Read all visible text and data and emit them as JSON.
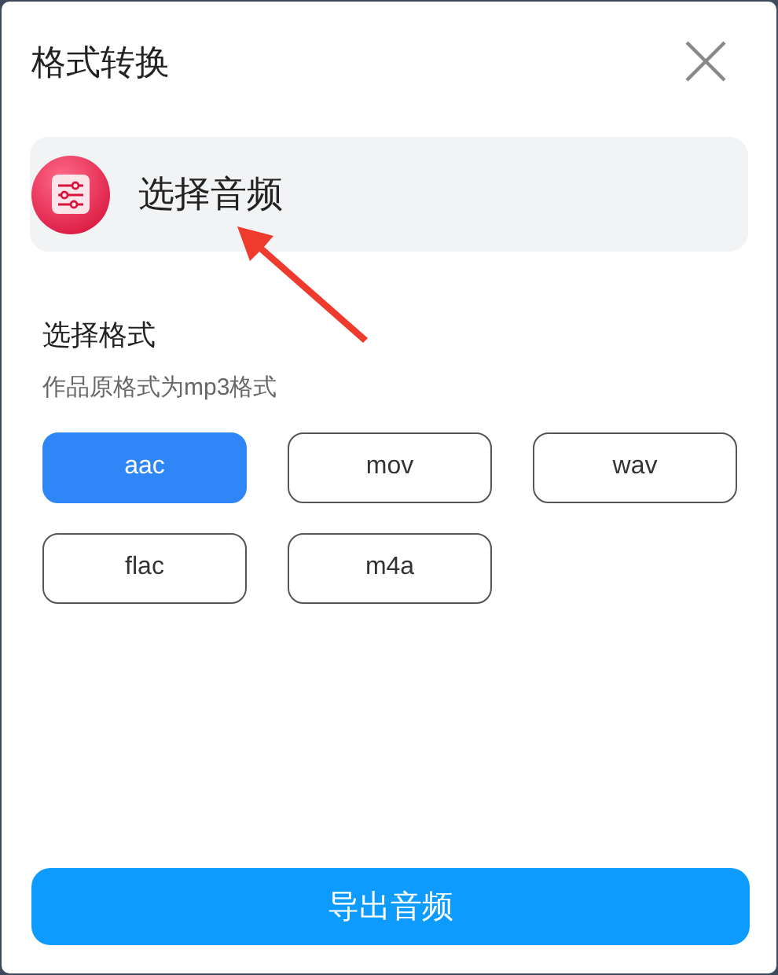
{
  "dialog": {
    "title": "格式转换"
  },
  "audio_picker": {
    "label": "选择音频"
  },
  "format_section": {
    "heading": "选择格式",
    "note": "作品原格式为mp3格式",
    "formats": [
      {
        "label": "aac",
        "selected": true
      },
      {
        "label": "mov",
        "selected": false
      },
      {
        "label": "wav",
        "selected": false
      },
      {
        "label": "flac",
        "selected": false
      },
      {
        "label": "m4a",
        "selected": false
      }
    ]
  },
  "export_button": "导出音频"
}
